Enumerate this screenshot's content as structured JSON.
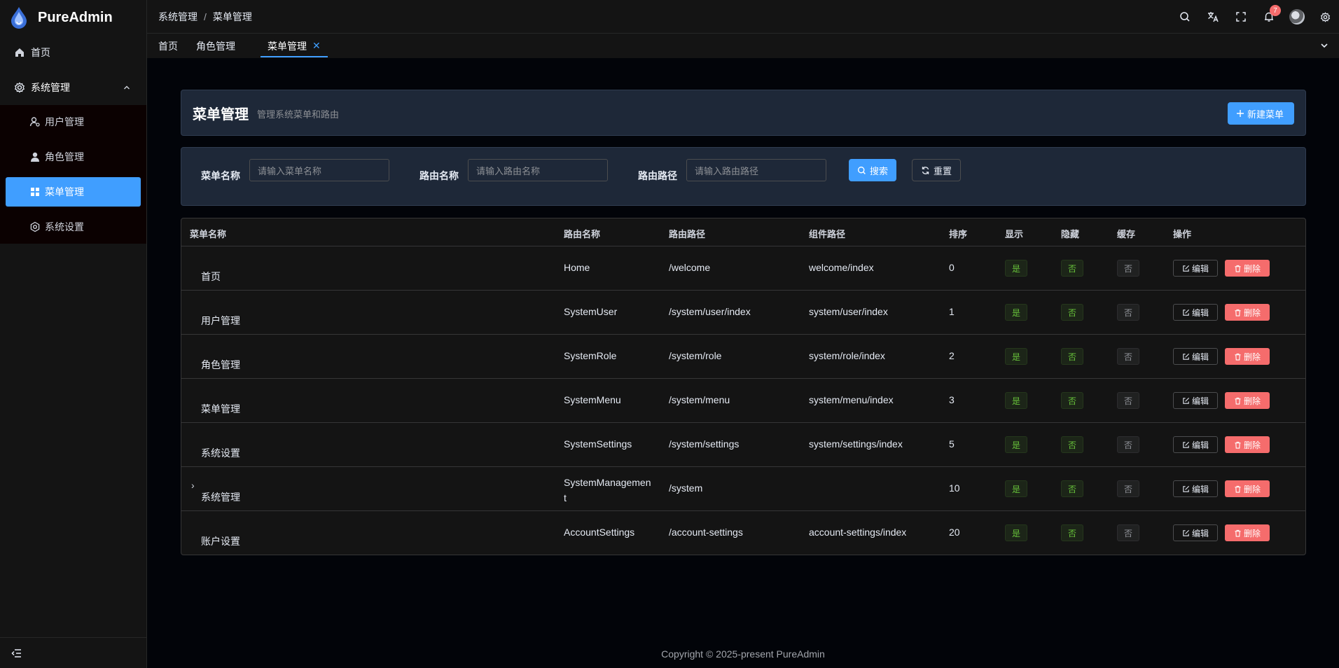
{
  "app": {
    "name": "PureAdmin"
  },
  "sidebar": {
    "home": "首页",
    "group": "系统管理",
    "items": [
      {
        "label": "用户管理",
        "icon": "user-settings-icon"
      },
      {
        "label": "角色管理",
        "icon": "role-icon"
      },
      {
        "label": "菜单管理",
        "icon": "menu-grid-icon",
        "active": true
      },
      {
        "label": "系统设置",
        "icon": "settings-icon"
      }
    ]
  },
  "breadcrumb": [
    "系统管理",
    "菜单管理"
  ],
  "breadcrumb_sep": "/",
  "notifications": {
    "count": "7"
  },
  "tabs": [
    {
      "label": "首页"
    },
    {
      "label": "角色管理"
    },
    {
      "label": "菜单管理",
      "active": true
    }
  ],
  "header": {
    "title": "菜单管理",
    "subtitle": "管理系统菜单和路由",
    "new_button": "新建菜单"
  },
  "filters": {
    "menu_name_label": "菜单名称",
    "menu_name_placeholder": "请输入菜单名称",
    "route_name_label": "路由名称",
    "route_name_placeholder": "请输入路由名称",
    "route_path_label": "路由路径",
    "route_path_placeholder": "请输入路由路径",
    "search_button": "搜索",
    "reset_button": "重置"
  },
  "table": {
    "columns": [
      "菜单名称",
      "路由名称",
      "路由路径",
      "组件路径",
      "排序",
      "显示",
      "隐藏",
      "缓存",
      "操作"
    ],
    "edit_label": "编辑",
    "delete_label": "删除",
    "rows": [
      {
        "menu_name": "首页",
        "route_name": "Home",
        "route_path": "/welcome",
        "component": "welcome/index",
        "order": "0",
        "show": "是",
        "hidden": "否",
        "cache": "否"
      },
      {
        "menu_name": "用户管理",
        "route_name": "SystemUser",
        "route_path": "/system/user/index",
        "component": "system/user/index",
        "order": "1",
        "show": "是",
        "hidden": "否",
        "cache": "否"
      },
      {
        "menu_name": "角色管理",
        "route_name": "SystemRole",
        "route_path": "/system/role",
        "component": "system/role/index",
        "order": "2",
        "show": "是",
        "hidden": "否",
        "cache": "否"
      },
      {
        "menu_name": "菜单管理",
        "route_name": "SystemMenu",
        "route_path": "/system/menu",
        "component": "system/menu/index",
        "order": "3",
        "show": "是",
        "hidden": "否",
        "cache": "否"
      },
      {
        "menu_name": "系统设置",
        "route_name": "SystemSettings",
        "route_path": "/system/settings",
        "component": "system/settings/index",
        "order": "5",
        "show": "是",
        "hidden": "否",
        "cache": "否"
      },
      {
        "menu_name": "系统管理",
        "route_name": "SystemManagement",
        "route_path": "/system",
        "component": "",
        "order": "10",
        "show": "是",
        "hidden": "否",
        "cache": "否",
        "expandable": true
      },
      {
        "menu_name": "账户设置",
        "route_name": "AccountSettings",
        "route_path": "/account-settings",
        "component": "account-settings/index",
        "order": "20",
        "show": "是",
        "hidden": "否",
        "cache": "否"
      }
    ]
  },
  "footer": "Copyright © 2025-present PureAdmin",
  "colors": {
    "primary": "#409eff",
    "danger": "#f56c6c",
    "success": "#67c23a"
  }
}
